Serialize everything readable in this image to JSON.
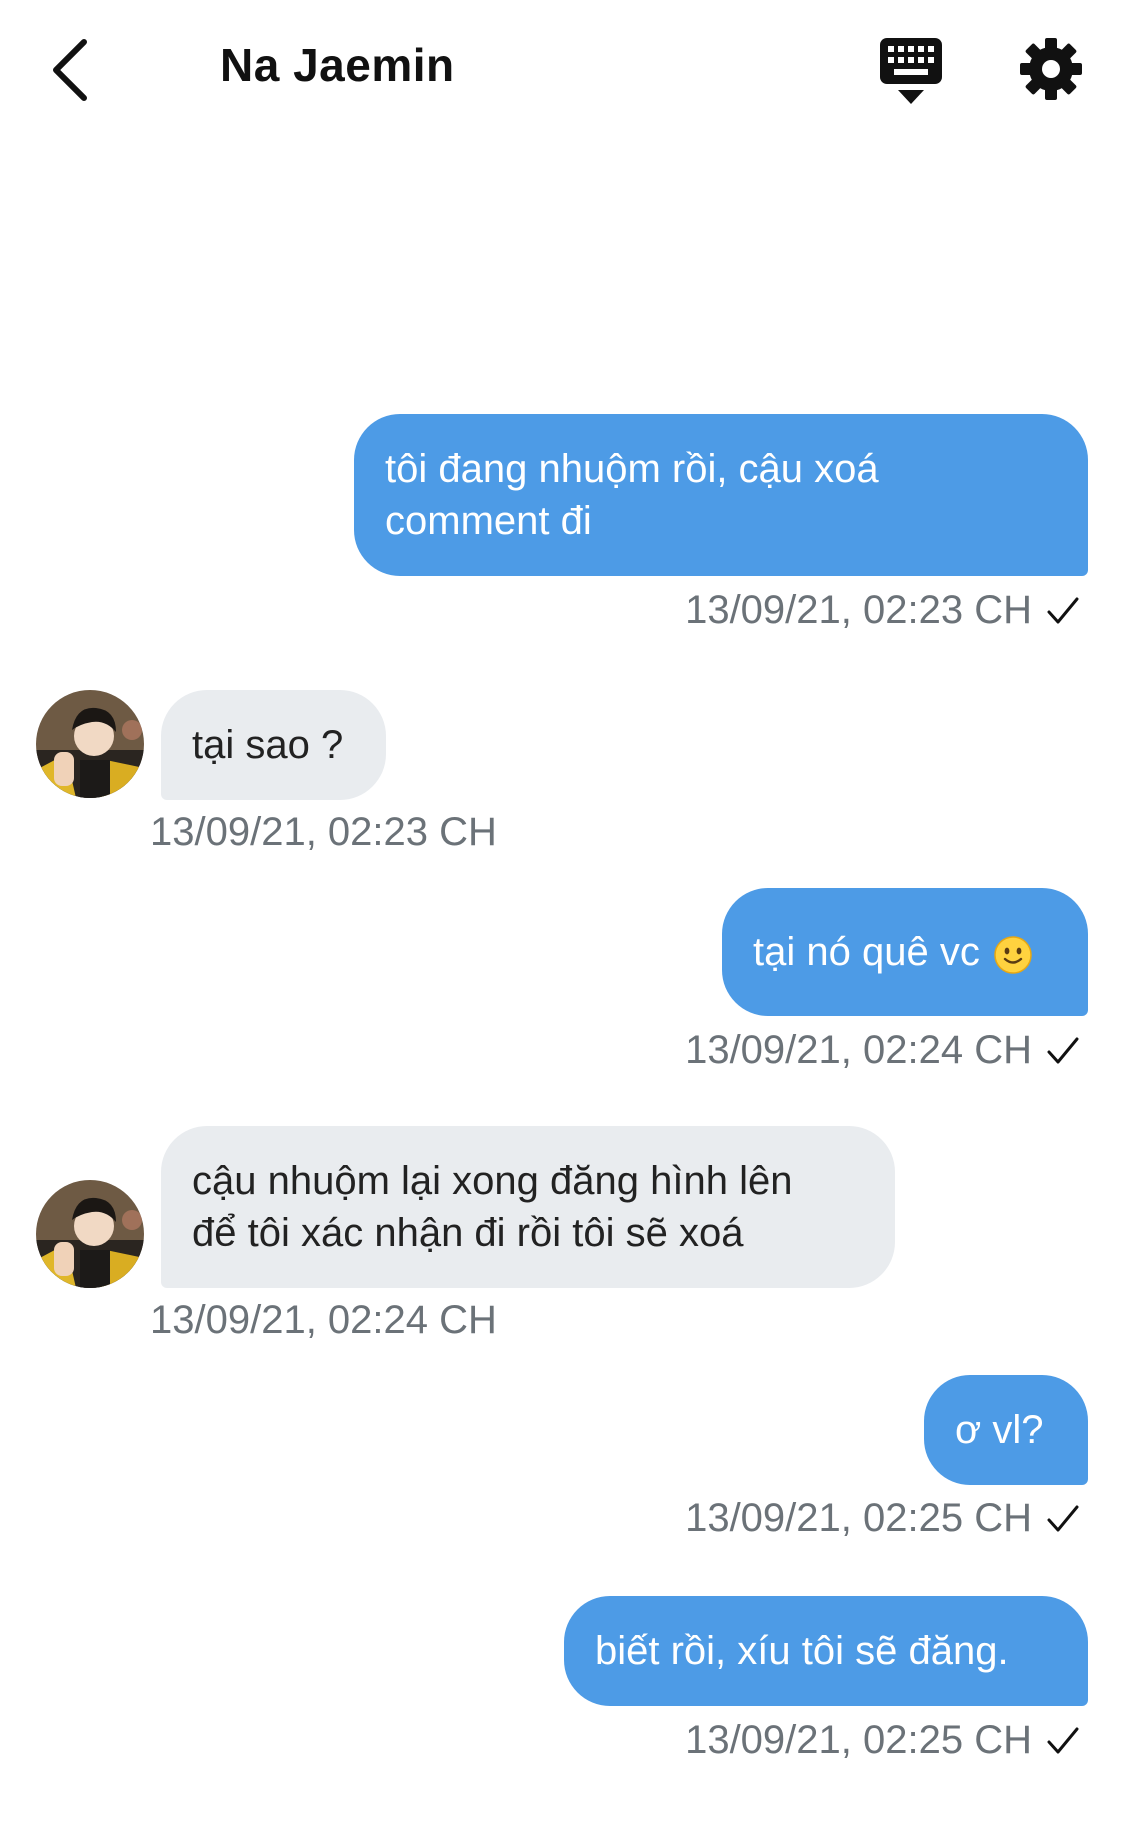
{
  "header": {
    "title": "Na Jaemin"
  },
  "colors": {
    "outgoing_bubble": "#4d9be6",
    "incoming_bubble": "#e9ecef",
    "timestamp": "#6b7278"
  },
  "icons": {
    "back": "chevron-left-icon",
    "keyboard": "keyboard-icon",
    "settings": "gear-icon",
    "read_receipt": "checkmark-icon",
    "emoji": "slightly-smiling-face-icon"
  },
  "messages": [
    {
      "from": "me",
      "lines": [
        "tôi đang nhuộm rồi, cậu xoá",
        "comment đi"
      ],
      "time": "13/09/21, 02:23 CH"
    },
    {
      "from": "them",
      "lines": [
        "tại sao ?"
      ],
      "time": "13/09/21, 02:23 CH"
    },
    {
      "from": "me",
      "lines": [
        "tại nó quê vc"
      ],
      "emoji": "🙂",
      "time": "13/09/21, 02:24 CH"
    },
    {
      "from": "them",
      "lines": [
        "cậu nhuộm lại xong đăng hình lên",
        "để tôi xác nhận đi rồi tôi sẽ xoá"
      ],
      "time": "13/09/21, 02:24 CH"
    },
    {
      "from": "me",
      "lines": [
        "ơ vl?"
      ],
      "time": "13/09/21, 02:25 CH"
    },
    {
      "from": "me",
      "lines": [
        "biết rồi, xíu tôi sẽ đăng."
      ],
      "time": "13/09/21, 02:25 CH"
    }
  ]
}
